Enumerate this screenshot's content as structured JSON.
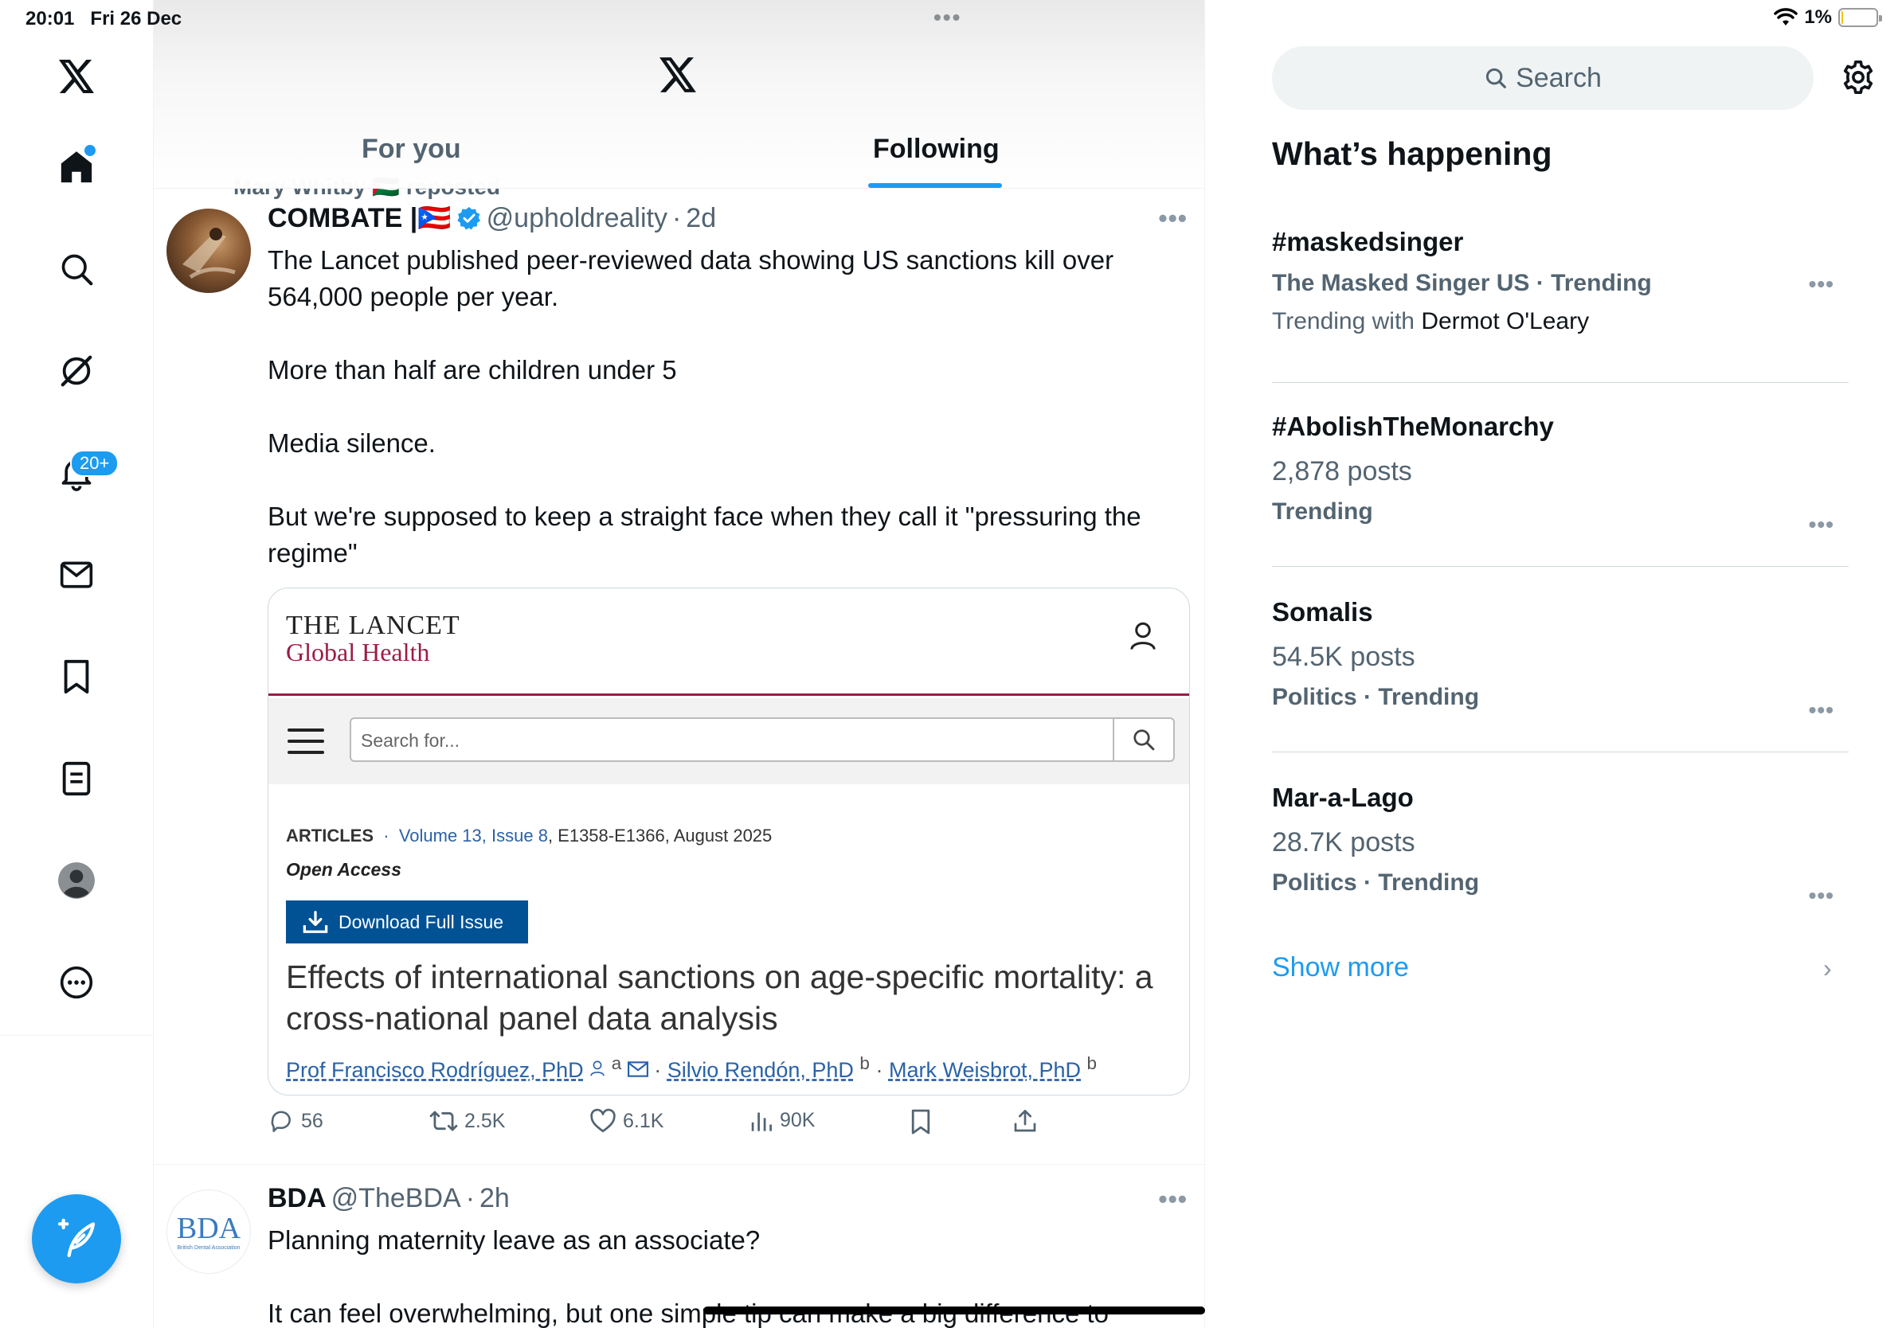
{
  "status": {
    "time": "20:01",
    "date": "Fri 26 Dec",
    "battery": "1%",
    "battery_level": 0.01
  },
  "nav": {
    "items": [
      "x-logo",
      "home",
      "explore",
      "grok",
      "notifications",
      "messages",
      "bookmarks",
      "lists",
      "profile",
      "more"
    ],
    "notifications_badge": "20+"
  },
  "tabs": [
    {
      "label": "For you",
      "active": false
    },
    {
      "label": "Following",
      "active": true
    }
  ],
  "repost": {
    "label": "Mary Whitby 🇵🇸 reposted"
  },
  "post1": {
    "name": "COMBATE |🇵🇷",
    "handle": "@upholdreality",
    "time": "2d",
    "verified": true,
    "paragraphs": [
      "The Lancet published peer-reviewed data showing US sanctions kill over 564,000 people per year.",
      "More than half are children under 5",
      "Media silence.",
      "But we're supposed to keep a straight face when they call it \"pressuring the regime\""
    ],
    "card": {
      "journal": "THE LANCET",
      "subtitle": "Global Health",
      "search_placeholder": "Search for...",
      "section": "ARTICLES",
      "volume": "Volume 13, Issue 8",
      "pages": ", E1358-E1366, August 2025",
      "open_access": "Open Access",
      "download": "Download Full Issue",
      "article_title": "Effects of international sanctions on age-specific mortality: a cross-national panel data analysis",
      "author1": "Prof Francisco Rodríguez, PhD",
      "author1_sup": "a",
      "author2": "Silvio Rendón, PhD",
      "author2_sup": "b",
      "author3": "Mark Weisbrot, PhD",
      "author3_sup": "b"
    },
    "actions": {
      "replies": "56",
      "reposts": "2.5K",
      "likes": "6.1K",
      "views": "90K"
    }
  },
  "post2": {
    "name": "BDA",
    "handle": "@TheBDA",
    "time": "2h",
    "avatar_text": "BDA",
    "avatar_subtext": "British Dental Association",
    "line1": "Planning maternity leave as an associate?",
    "line2": "It can feel overwhelming, but one simple tip can make a big difference to"
  },
  "right": {
    "search_label": "Search",
    "heading": "What’s happening",
    "trends": [
      {
        "title": "#maskedsinger",
        "line1": "The Masked Singer US · Trending",
        "line2_prefix": "Trending with ",
        "line2_name": "Dermot O'Leary"
      },
      {
        "title": "#AbolishTheMonarchy",
        "line1": "2,878 posts",
        "line2": "Trending"
      },
      {
        "title": "Somalis",
        "line1": "54.5K posts",
        "line2": "Politics · Trending"
      },
      {
        "title": "Mar-a-Lago",
        "line1": "28.7K posts",
        "line2": "Politics · Trending"
      }
    ],
    "show_more": "Show more"
  },
  "colors": {
    "accent": "#1d9bf0",
    "text": "#0f1419",
    "secondary": "#536471",
    "lancet": "#9b1d45",
    "lancet_button": "#005294"
  }
}
